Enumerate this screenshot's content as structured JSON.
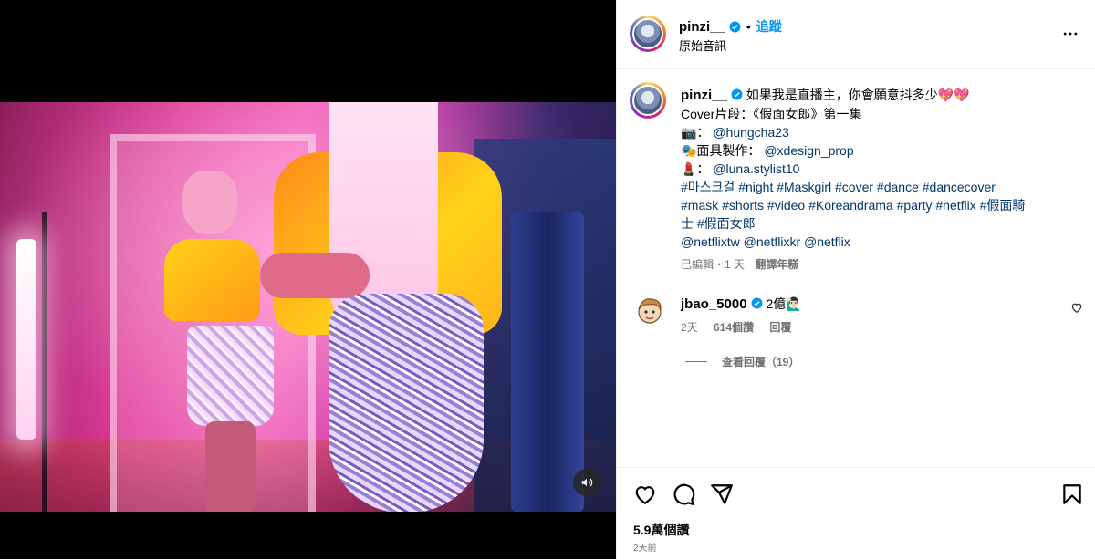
{
  "post": {
    "username": "pinzi__",
    "follow_label": "追蹤",
    "dot": "•",
    "audio": "原始音訊"
  },
  "caption": {
    "username": "pinzi__",
    "lines": [
      "如果我是直播主，你會願意抖多少💖💖",
      "Cover片段：《假面女郎》第一集"
    ],
    "camera_prefix": "📷：",
    "camera_tag": "@hungcha23",
    "mask_prefix": "🎭面具製作：",
    "mask_tag": "@xdesign_prop",
    "stylist_prefix": "💄：",
    "stylist_tag": "@luna.stylist10",
    "hashtags_1": "#마스크걸 #night #Maskgirl #cover #dance #dancecover",
    "hashtags_2": "#mask #shorts #video #Koreandrama #party #netflix #假面騎",
    "hashtags_3": "士 #假面女郎",
    "mentions": "@netflixtw @netflixkr @netflix",
    "meta": "已編輯・1 天",
    "see_translation": "翻譯年糕"
  },
  "comment": {
    "username": "jbao_5000",
    "text": "2億🙋🏻‍♂️",
    "time": "2天",
    "likes": "614個讚",
    "reply": "回覆",
    "view_replies": "查看回覆（19）"
  },
  "footer": {
    "likes": "5.9萬個讚",
    "time": "2天前"
  },
  "icons": {
    "verified": "verified-badge-icon",
    "more": "more-options-icon",
    "heart": "heart-icon",
    "comment": "comment-icon",
    "share": "share-icon",
    "save": "bookmark-icon",
    "sound": "sound-on-icon"
  },
  "colors": {
    "accent": "#0095f6",
    "hashtag": "#00376b",
    "muted": "#737373"
  }
}
